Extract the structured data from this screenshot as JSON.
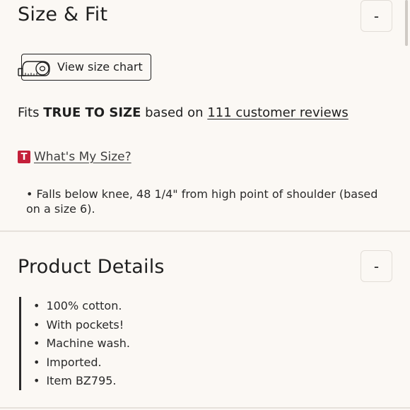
{
  "size_fit": {
    "title": "Size & Fit",
    "collapse_symbol": "-",
    "size_chart_button": "View size chart",
    "size_chart_icon": "measuring-tape-icon",
    "fit_prefix": "Fits ",
    "fit_value": "TRUE TO SIZE",
    "fit_middle": " based on ",
    "reviews_link": "111 customer reviews",
    "badge_letter": "T",
    "badge_color": "#c4203a",
    "whats_my_size": "What's My Size?",
    "fall_note": "•  Falls below knee, 48 1/4\" from high point of shoulder (based on a size 6)."
  },
  "product_details": {
    "title": "Product Details",
    "collapse_symbol": "-",
    "items": [
      "100% cotton.",
      "With pockets!",
      "Machine wash.",
      "Imported.",
      "Item BZ795."
    ]
  }
}
